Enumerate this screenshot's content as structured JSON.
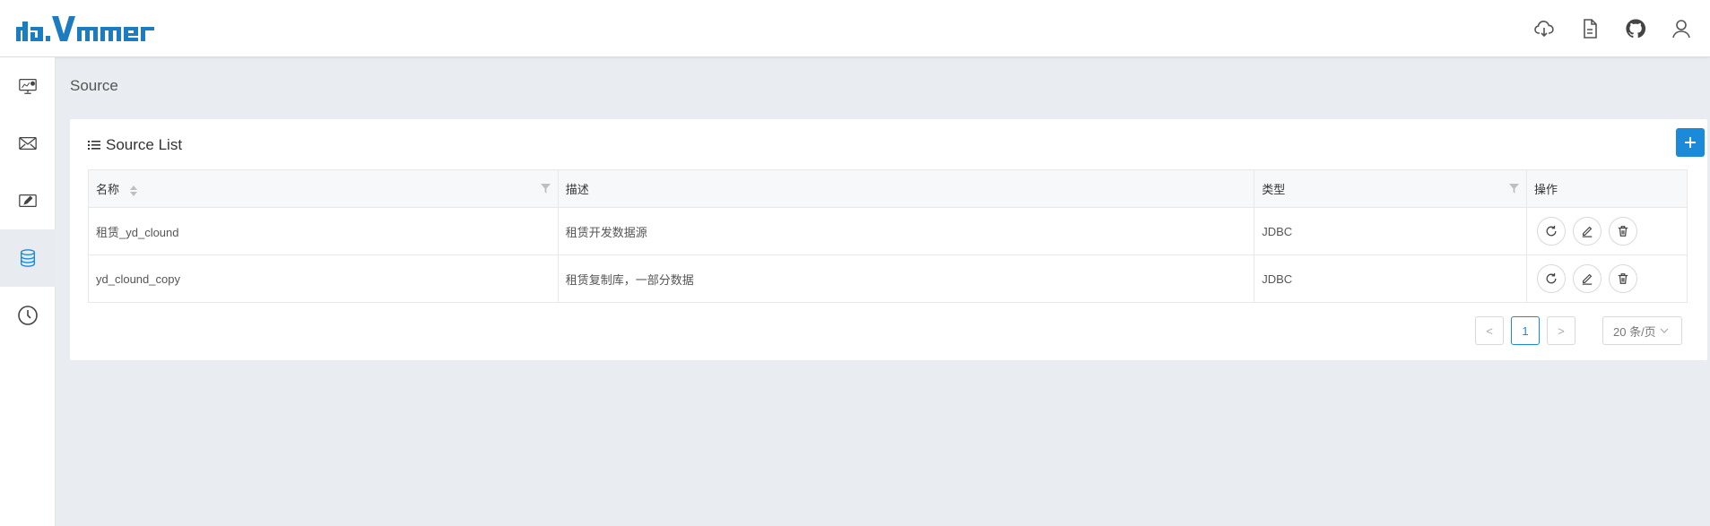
{
  "app": {
    "logo_text": "davinci",
    "colors": {
      "brand": "#1b7cc1",
      "accent": "#1b8ad8",
      "background": "#e9ecf1"
    }
  },
  "header": {
    "icons": [
      "download-cloud-icon",
      "document-icon",
      "github-icon",
      "user-icon"
    ]
  },
  "sidebar": {
    "items": [
      {
        "icon": "dashboard-monitor-icon",
        "active": false
      },
      {
        "icon": "widget-icon",
        "active": false
      },
      {
        "icon": "view-editor-icon",
        "active": false
      },
      {
        "icon": "database-icon",
        "active": true
      },
      {
        "icon": "clock-schedule-icon",
        "active": false
      }
    ]
  },
  "breadcrumb": {
    "title": "Source"
  },
  "card": {
    "title": "Source List",
    "add_button_label": "+"
  },
  "table": {
    "columns": [
      "名称",
      "描述",
      "类型",
      "操作"
    ],
    "rows": [
      {
        "name": "租赁_yd_clound",
        "description": "租赁开发数据源",
        "type": "JDBC"
      },
      {
        "name": "yd_clound_copy",
        "description": "租赁复制库，一部分数据",
        "type": "JDBC"
      }
    ]
  },
  "pagination": {
    "prev_label": "<",
    "current_page": "1",
    "next_label": ">",
    "page_size_label": "20 条/页"
  }
}
